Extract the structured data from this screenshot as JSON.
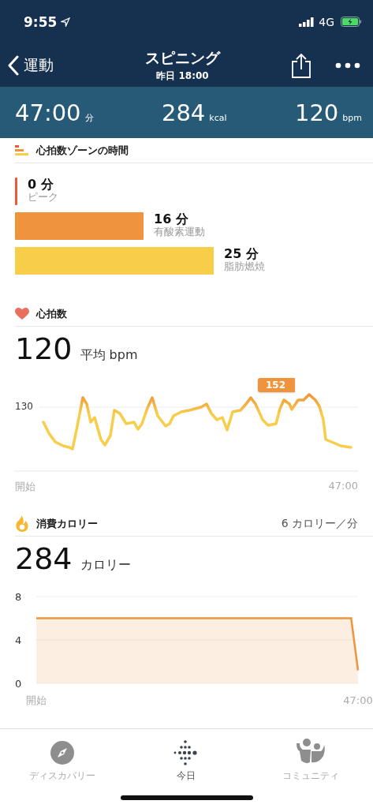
{
  "status_bar": {
    "time": "9:55",
    "network": "4G"
  },
  "nav": {
    "back": "運動",
    "title": "スピニング",
    "subtitle": "昨日 18:00"
  },
  "summary": [
    {
      "value": "47:00",
      "unit": "分"
    },
    {
      "value": "284",
      "unit": "kcal"
    },
    {
      "value": "120",
      "unit": "bpm"
    }
  ],
  "zones": {
    "title": "心拍数ゾーンの時間",
    "items": [
      {
        "minutes": "0 分",
        "label": "ピーク",
        "color": "#ea5b3c",
        "kind": "line"
      },
      {
        "minutes": "16 分",
        "label": "有酸素運動",
        "color": "#ef943d",
        "kind": "bar"
      },
      {
        "minutes": "25 分",
        "label": "脂肪燃焼",
        "color": "#f7cd4a",
        "kind": "bar"
      }
    ]
  },
  "heart_rate": {
    "title": "心拍数",
    "value": "120",
    "unit": "平均 bpm",
    "tick": "130",
    "tooltip": "152",
    "x_start": "開始",
    "x_end": "47:00"
  },
  "calories": {
    "title": "消費カロリー",
    "rate": "6 カロリー／分",
    "value": "284",
    "unit": "カロリー",
    "chart_data": {
      "type": "area",
      "categories": [
        "開始",
        null,
        null,
        null,
        null,
        null,
        null,
        null,
        null,
        null,
        null,
        null,
        null,
        null,
        null,
        null,
        null,
        null,
        null,
        null,
        null,
        null,
        null,
        null,
        null,
        null,
        null,
        null,
        null,
        null,
        null,
        null,
        null,
        null,
        null,
        null,
        null,
        null,
        null,
        null,
        null,
        null,
        null,
        null,
        null,
        null,
        null,
        "47:00"
      ],
      "ylim": [
        0,
        8
      ],
      "yticks": [
        0,
        4,
        8
      ],
      "series": [
        {
          "color": "#ef943d",
          "values": [
            6,
            6,
            6,
            6,
            6,
            6,
            6,
            6,
            6,
            6,
            6,
            6,
            6,
            6,
            6,
            6,
            6,
            6,
            6,
            6,
            6,
            6,
            6,
            6,
            6,
            6,
            6,
            6,
            6,
            6,
            6,
            6,
            6,
            6,
            6,
            6,
            6,
            6,
            6,
            6,
            6,
            6,
            6,
            6,
            6,
            6,
            6,
            1.2
          ]
        }
      ]
    }
  },
  "tab_bar": [
    {
      "label": "ディスカバリー",
      "selected": false
    },
    {
      "label": "今日",
      "selected": true
    },
    {
      "label": "コミュニティ",
      "selected": false
    }
  ]
}
